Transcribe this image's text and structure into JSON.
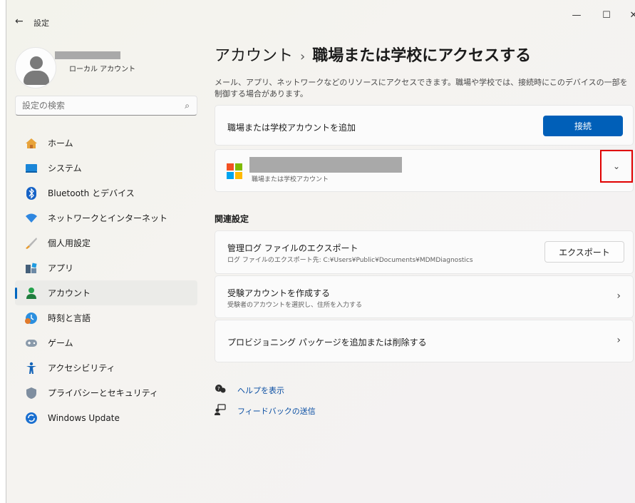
{
  "window": {
    "title": "設定",
    "back": "←",
    "minimize": "—",
    "maximize": "☐",
    "close": "✕"
  },
  "profile": {
    "account_type": "ローカル アカウント"
  },
  "search": {
    "placeholder": "設定の検索",
    "icon": "⌕"
  },
  "sidebar": {
    "items": [
      {
        "label": "ホーム",
        "icon": "home-icon"
      },
      {
        "label": "システム",
        "icon": "system-icon"
      },
      {
        "label": "Bluetooth とデバイス",
        "icon": "bluetooth-icon"
      },
      {
        "label": "ネットワークとインターネット",
        "icon": "network-icon"
      },
      {
        "label": "個人用設定",
        "icon": "personalization-icon"
      },
      {
        "label": "アプリ",
        "icon": "apps-icon"
      },
      {
        "label": "アカウント",
        "icon": "accounts-icon",
        "active": true
      },
      {
        "label": "時刻と言語",
        "icon": "time-language-icon"
      },
      {
        "label": "ゲーム",
        "icon": "gaming-icon"
      },
      {
        "label": "アクセシビリティ",
        "icon": "accessibility-icon"
      },
      {
        "label": "プライバシーとセキュリティ",
        "icon": "privacy-icon"
      },
      {
        "label": "Windows Update",
        "icon": "windows-update-icon"
      }
    ]
  },
  "main": {
    "breadcrumb_parent": "アカウント",
    "breadcrumb_sep": "›",
    "breadcrumb_current": "職場または学校にアクセスする",
    "description": "メール、アプリ、ネットワークなどのリソースにアクセスできます。職場や学校では、接続時にこのデバイスの一部を制御する場合があります。",
    "add_account": {
      "label": "職場または学校アカウントを追加",
      "button": "接続"
    },
    "account_entry": {
      "subtitle": "職場または学校アカウント",
      "chevron": "⌄"
    },
    "related_heading": "関連設定",
    "related": [
      {
        "title": "管理ログ ファイルのエクスポート",
        "subtitle": "ログ ファイルのエクスポート先: C:¥Users¥Public¥Documents¥MDMDiagnostics",
        "button": "エクスポート"
      },
      {
        "title": "受験アカウントを作成する",
        "subtitle": "受験者のアカウントを選択し、住所を入力する",
        "chevron": "›"
      },
      {
        "title": "プロビジョニング パッケージを追加または削除する",
        "chevron": "›"
      }
    ],
    "links": [
      {
        "label": "ヘルプを表示",
        "icon": "help-icon"
      },
      {
        "label": "フィードバックの送信",
        "icon": "feedback-icon"
      }
    ]
  },
  "colors": {
    "accent": "#005fb8",
    "highlight_box": "#e00000"
  }
}
